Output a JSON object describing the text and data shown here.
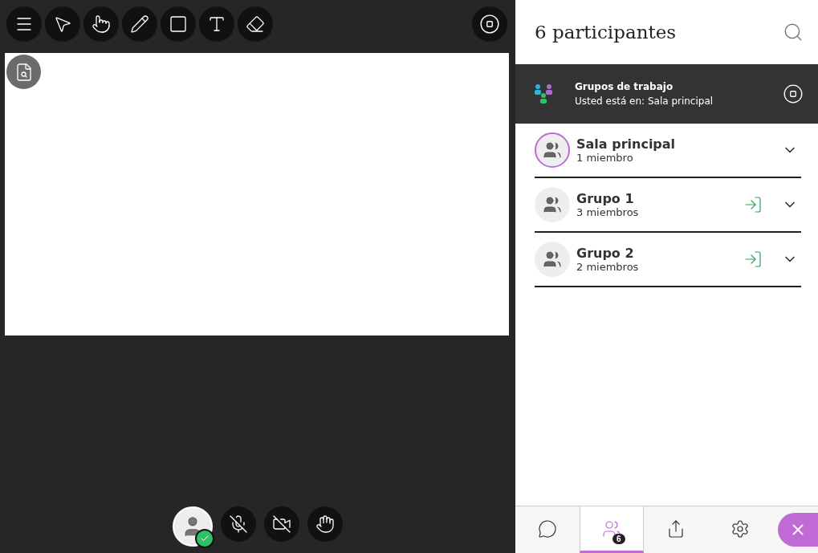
{
  "toolbar": {
    "tools": [
      {
        "kind": "menu",
        "selected": false
      },
      {
        "kind": "select",
        "selected": false
      },
      {
        "kind": "pan",
        "selected": false
      },
      {
        "kind": "pencil",
        "selected": false
      },
      {
        "kind": "shape",
        "selected": false
      },
      {
        "kind": "text",
        "selected": false
      },
      {
        "kind": "eraser",
        "selected": false
      }
    ]
  },
  "panel": {
    "title": "6 participantes"
  },
  "breakout": {
    "title": "Grupos de trabajo",
    "subtitle": "Usted está en: Sala principal"
  },
  "groups": [
    {
      "name": "Sala principal",
      "members": "1 miembro",
      "selected": true,
      "joinable": false
    },
    {
      "name": "Grupo 1",
      "members": "3 miembros",
      "selected": false,
      "joinable": true
    },
    {
      "name": "Grupo 2",
      "members": "2 miembros",
      "selected": false,
      "joinable": true
    }
  ],
  "controls": [
    {
      "kind": "avatar"
    },
    {
      "kind": "mic"
    },
    {
      "kind": "camera"
    },
    {
      "kind": "hand"
    }
  ],
  "tabs": [
    {
      "kind": "chat",
      "selected": false
    },
    {
      "kind": "participants",
      "selected": true,
      "badge": "6"
    },
    {
      "kind": "share",
      "selected": false
    },
    {
      "kind": "settings",
      "selected": false
    }
  ]
}
